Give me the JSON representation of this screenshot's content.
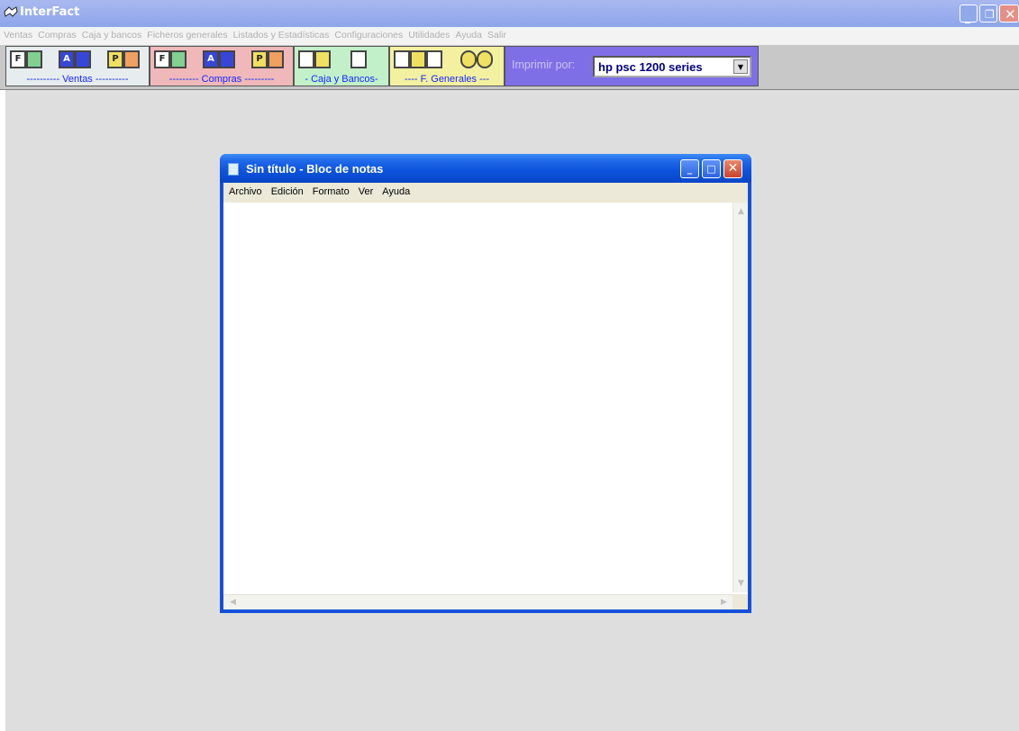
{
  "app": {
    "title": "InterFact",
    "menu": [
      "Ventas",
      "Compras",
      "Caja y bancos",
      "Ficheros generales",
      "Listados y Estadísticas",
      "Configuraciones",
      "Utilidades",
      "Ayuda",
      "Salir"
    ]
  },
  "toolbar": {
    "groups": [
      {
        "label": "---------- Ventas ----------"
      },
      {
        "label": "--------- Compras ---------"
      },
      {
        "label": "- Caja y Bancos-"
      },
      {
        "label": "---- F. Generales ---"
      }
    ],
    "icons": [
      "F",
      "A",
      "P"
    ],
    "print_label": "Imprimir por:",
    "printer_value": "hp psc 1200 series"
  },
  "notepad": {
    "title": "Sin título - Bloc de notas",
    "menu": [
      "Archivo",
      "Edición",
      "Formato",
      "Ver",
      "Ayuda"
    ],
    "content": ""
  }
}
